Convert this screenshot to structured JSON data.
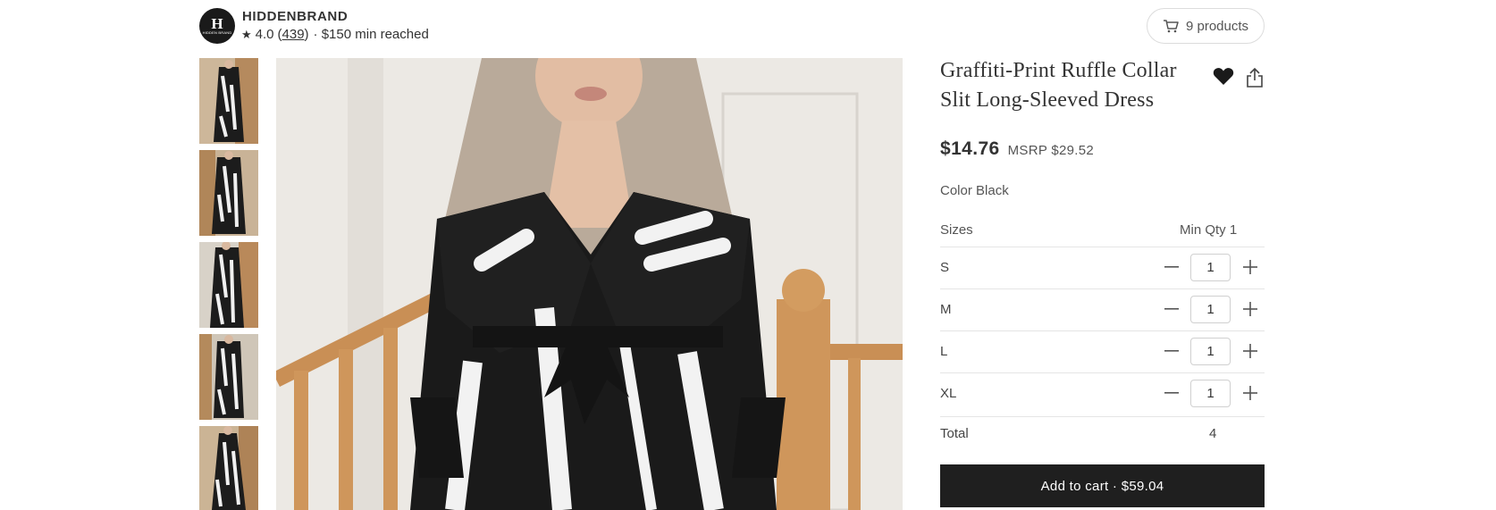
{
  "header": {
    "brand_logo_letter": "H",
    "brand_logo_sub": "HIDDEN BRAND",
    "brand_name": "HIDDENBRAND",
    "rating": "4.0",
    "review_count": "439",
    "min_status": "· $150 min reached",
    "products_label": "9 products"
  },
  "product": {
    "title": "Graffiti-Print Ruffle Collar Slit Long-Sleeved Dress",
    "price": "$14.76",
    "msrp": "MSRP $29.52",
    "color_label": "Color",
    "color_value": "Black",
    "favorited": true
  },
  "sizes": {
    "label": "Sizes",
    "min_qty": "Min Qty 1",
    "rows": [
      {
        "size": "S",
        "qty": "1"
      },
      {
        "size": "M",
        "qty": "1"
      },
      {
        "size": "L",
        "qty": "1"
      },
      {
        "size": "XL",
        "qty": "1"
      }
    ],
    "total_label": "Total",
    "total_value": "4"
  },
  "cart": {
    "button_label": "Add to cart · $59.04"
  },
  "gallery": {
    "thumbnail_count": 5,
    "main_image_icon": "dress-photo-icon"
  },
  "colors": {
    "accent_dark": "#1f1f1f",
    "heart": "#1a1a1a"
  }
}
